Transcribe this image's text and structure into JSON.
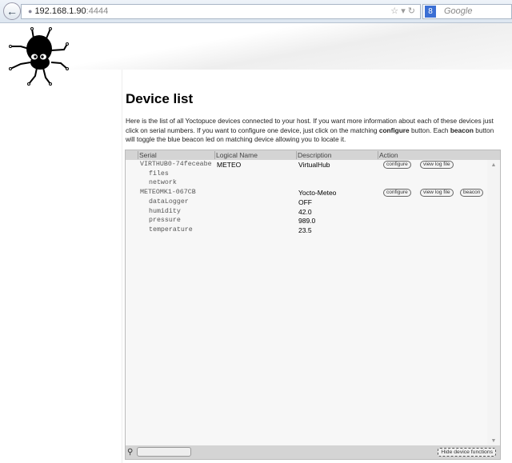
{
  "browser": {
    "url_host": "192.168.1.90",
    "url_port": ":4444",
    "search_placeholder": "Google",
    "back_icon": "arrow-left-icon"
  },
  "page": {
    "title": "Device list",
    "intro_1": "Here is the list of all Yoctopuce devices connected to your host. If you want more information about each of these devices just click on serial numbers. If you want to configure one device, just click on the matching ",
    "intro_bold1": "configure",
    "intro_2": " button. Each ",
    "intro_bold2": "beacon",
    "intro_3": " button will toggle the blue beacon led on matching device allowing you to locate it."
  },
  "table": {
    "headers": [
      "Serial",
      "Logical Name",
      "Description",
      "Action"
    ],
    "rows": [
      {
        "serial": "VIRTHUB0-74feceabe",
        "logical": "METEO",
        "desc": "VirtualHub",
        "configure": "configure",
        "log": "view log file"
      },
      {
        "serial": "files"
      },
      {
        "serial": "network"
      },
      {
        "serial": "METEOMK1-067CB",
        "desc": "Yocto-Meteo",
        "configure": "configure",
        "log": "view log file",
        "beacon": "beacon"
      },
      {
        "serial": "dataLogger",
        "desc": "OFF"
      },
      {
        "serial": "humidity",
        "desc": "42.0"
      },
      {
        "serial": "pressure",
        "desc": "989.0"
      },
      {
        "serial": "temperature",
        "desc": "23.5"
      }
    ],
    "hide_button": "Hide device functions"
  }
}
